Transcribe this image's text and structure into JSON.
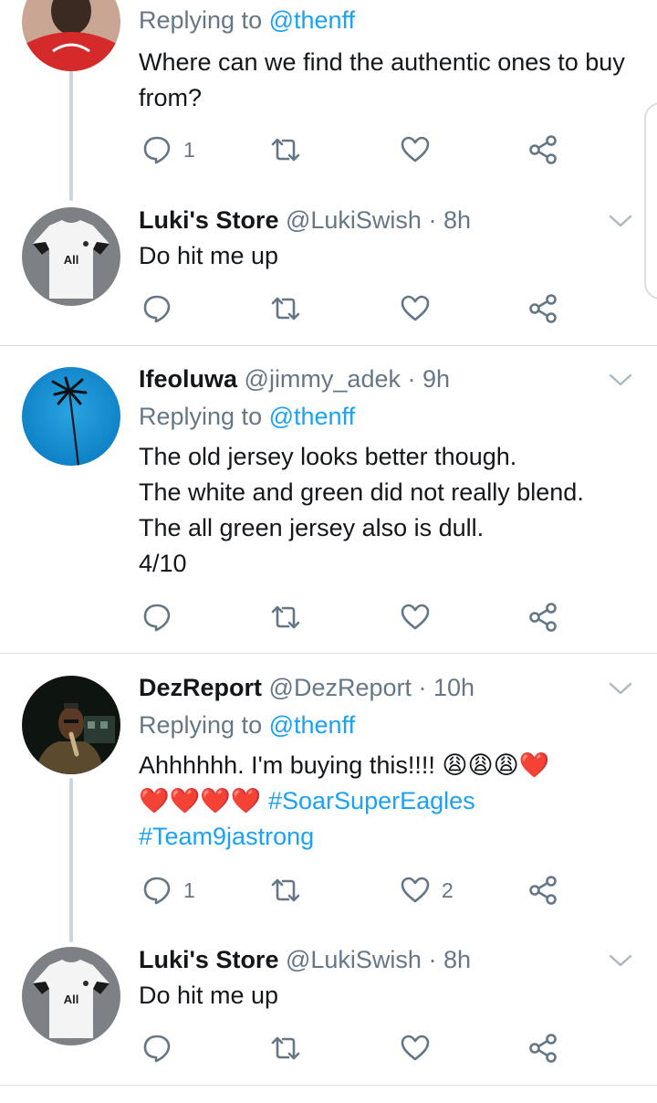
{
  "tweets": [
    {
      "reply_prefix": "Replying to ",
      "reply_to": "@thenff",
      "text": "Where can we find the authentic ones to buy from?",
      "reply_count": "1",
      "like_count": ""
    },
    {
      "name": "Luki's Store",
      "handle": "@LukiSwish",
      "time": "· 8h",
      "text": "Do hit me up",
      "jersey_text": "All",
      "reply_count": "",
      "like_count": ""
    },
    {
      "name": "Ifeoluwa",
      "handle": "@jimmy_adek",
      "time": "· 9h",
      "reply_prefix": "Replying to ",
      "reply_to": "@thenff",
      "text": "The old jersey looks better though.\nThe white and green did not really blend.\nThe all green jersey also is dull.\n4/10",
      "reply_count": "",
      "like_count": ""
    },
    {
      "name": "DezReport",
      "handle": "@DezReport",
      "time": "· 10h",
      "reply_prefix": "Replying to ",
      "reply_to": "@thenff",
      "text_prefix": "Ahhhhhh. I'm buying this!!!! ",
      "emojis_line1": "😩😩😩❤️",
      "emojis_line2": "❤️❤️❤️❤️",
      "hashtag1": "#SoarSuperEagles",
      "hashtag2": "#Team9jastrong",
      "reply_count": "1",
      "like_count": "2"
    },
    {
      "name": "Luki's Store",
      "handle": "@LukiSwish",
      "time": "· 8h",
      "text": "Do hit me up",
      "jersey_text": "All",
      "reply_count": "",
      "like_count": ""
    }
  ],
  "icons": {
    "reply": "reply-icon",
    "retweet": "retweet-icon",
    "like": "like-icon",
    "share": "share-icon",
    "caret": "chevron-down-icon"
  },
  "colors": {
    "text": "#14171a",
    "secondary": "#657786",
    "link": "#1da1f2",
    "thread_line": "#ccd6dd",
    "divider": "#d9dee2"
  }
}
